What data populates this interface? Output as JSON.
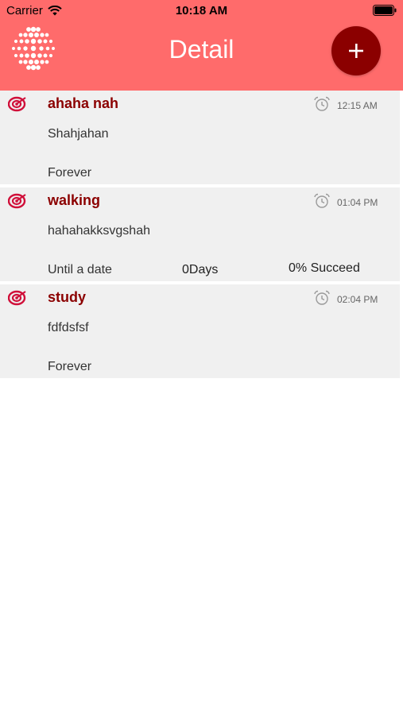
{
  "status_bar": {
    "carrier": "Carrier",
    "time": "10:18 AM"
  },
  "nav": {
    "title": "Detail",
    "add_label": "+"
  },
  "colors": {
    "header_bg": "#ff6b6b",
    "accent": "#8b0000",
    "row_bg": "#f0f0f0"
  },
  "habits": [
    {
      "title": "ahaha nah",
      "alarm_time": "12:15 AM",
      "description": "Shahjahan",
      "repeat": "Forever",
      "days": "",
      "succeed": ""
    },
    {
      "title": "walking",
      "alarm_time": "01:04 PM",
      "description": "hahahakksvgshah",
      "repeat": "Until a date",
      "days": "0Days",
      "succeed": "0% Succeed"
    },
    {
      "title": "study",
      "alarm_time": "02:04 PM",
      "description": "fdfdsfsf",
      "repeat": "Forever",
      "days": "",
      "succeed": ""
    }
  ]
}
